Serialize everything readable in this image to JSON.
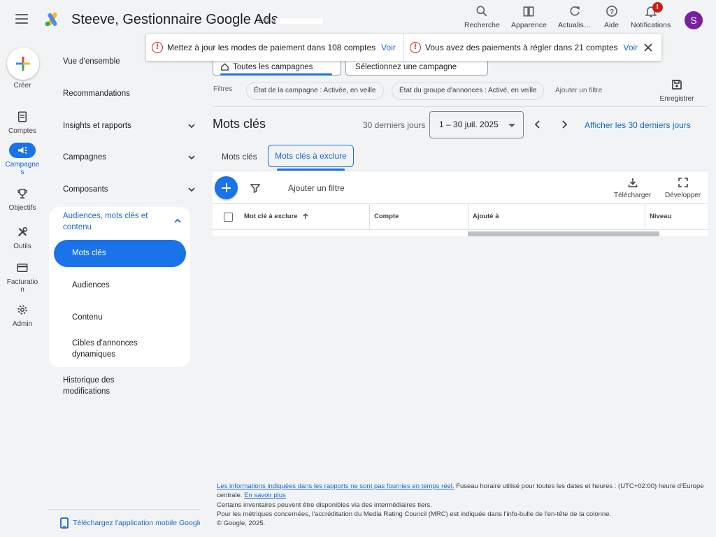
{
  "header": {
    "title": "Steeve, Gestionnaire Google Ads",
    "account_id": "142-40",
    "actions": [
      {
        "label": "Recherche",
        "icon": "search-icon"
      },
      {
        "label": "Apparence",
        "icon": "appearance-icon"
      },
      {
        "label": "Actualis…",
        "icon": "refresh-icon"
      },
      {
        "label": "Aide",
        "icon": "help-icon"
      },
      {
        "label": "Notifications",
        "icon": "bell-icon",
        "badge": "!"
      }
    ],
    "avatar_initial": "S",
    "avatar_color": "#7b1fa2"
  },
  "rail": {
    "create_label": "Créer",
    "items": [
      {
        "label": "Comptes",
        "icon": "accounts-icon"
      },
      {
        "label": "Campagne\ns",
        "icon": "megaphone-icon",
        "active": true
      },
      {
        "label": "Objectifs",
        "icon": "trophy-icon"
      },
      {
        "label": "Outils",
        "icon": "tools-icon"
      },
      {
        "label": "Facturatio\nn",
        "icon": "billing-icon"
      },
      {
        "label": "Admin",
        "icon": "gear-icon"
      }
    ]
  },
  "sidenav": {
    "items": [
      {
        "label": "Vue d'ensemble"
      },
      {
        "label": "Recommandations"
      },
      {
        "label": "Insights et rapports",
        "expandable": true
      },
      {
        "label": "Campagnes",
        "expandable": true
      },
      {
        "label": "Composants",
        "expandable": true
      },
      {
        "label": "Audiences, mots clés et contenu",
        "expanded": true
      }
    ],
    "sub_items": [
      {
        "label": "Mots clés",
        "selected": true
      },
      {
        "label": "Audiences"
      },
      {
        "label": "Contenu"
      },
      {
        "label": "Cibles d'annonces dynamiques"
      }
    ],
    "history": "Historique des modifications",
    "mobile_app": "Téléchargez l'application mobile Google Ads"
  },
  "notifications": [
    {
      "text": "Mettez à jour les modes de paiement dans 108 comptes",
      "link": "Voir"
    },
    {
      "text": "Vous avez des paiements à régler dans 21 comptes",
      "link": "Voir"
    }
  ],
  "scope": {
    "campaigns": "Toutes les campagnes",
    "campaign_select": "Sélectionnez une campagne"
  },
  "filters": {
    "label": "Filtres",
    "chips": [
      "État de la campagne : Activée, en veille",
      "État du groupe d'annonces : Activé, en veille"
    ],
    "add": "Ajouter un filtre",
    "save": "Enregistrer"
  },
  "page": {
    "title": "Mots clés",
    "date_label": "30 derniers jours",
    "date_range": "1 – 30 juil. 2025",
    "show_30": "Afficher les 30 derniers jours",
    "tabs": [
      "Mots clés",
      "Mots clés à exclure"
    ],
    "active_tab": 1
  },
  "table": {
    "add_filter": "Ajouter un filtre",
    "download": "Télécharger",
    "expand": "Développer",
    "columns": [
      "Mot clé à exclure",
      "Compte",
      "Ajouté à",
      "Niveau"
    ],
    "sort_icon": "arrow-up-icon"
  },
  "footer": {
    "line1_link": "Les informations indiquées dans les rapports ne sont pas fournies en temps réel.",
    "line1_text": " Fuseau horaire utilisé pour toutes les dates et heures : (UTC+02:00) heure d'Europe centrale. ",
    "learn_more": "En savoir plus",
    "line2": "Certains inventaires peuvent être disponibles via des intermédiaires tiers.",
    "line3": "Pour les métriques concernées, l'accréditation du Media Rating Council (MRC) est indiquée dans l'info-bulle de l'en-tête de la colonne.",
    "copyright": "© Google, 2025."
  }
}
